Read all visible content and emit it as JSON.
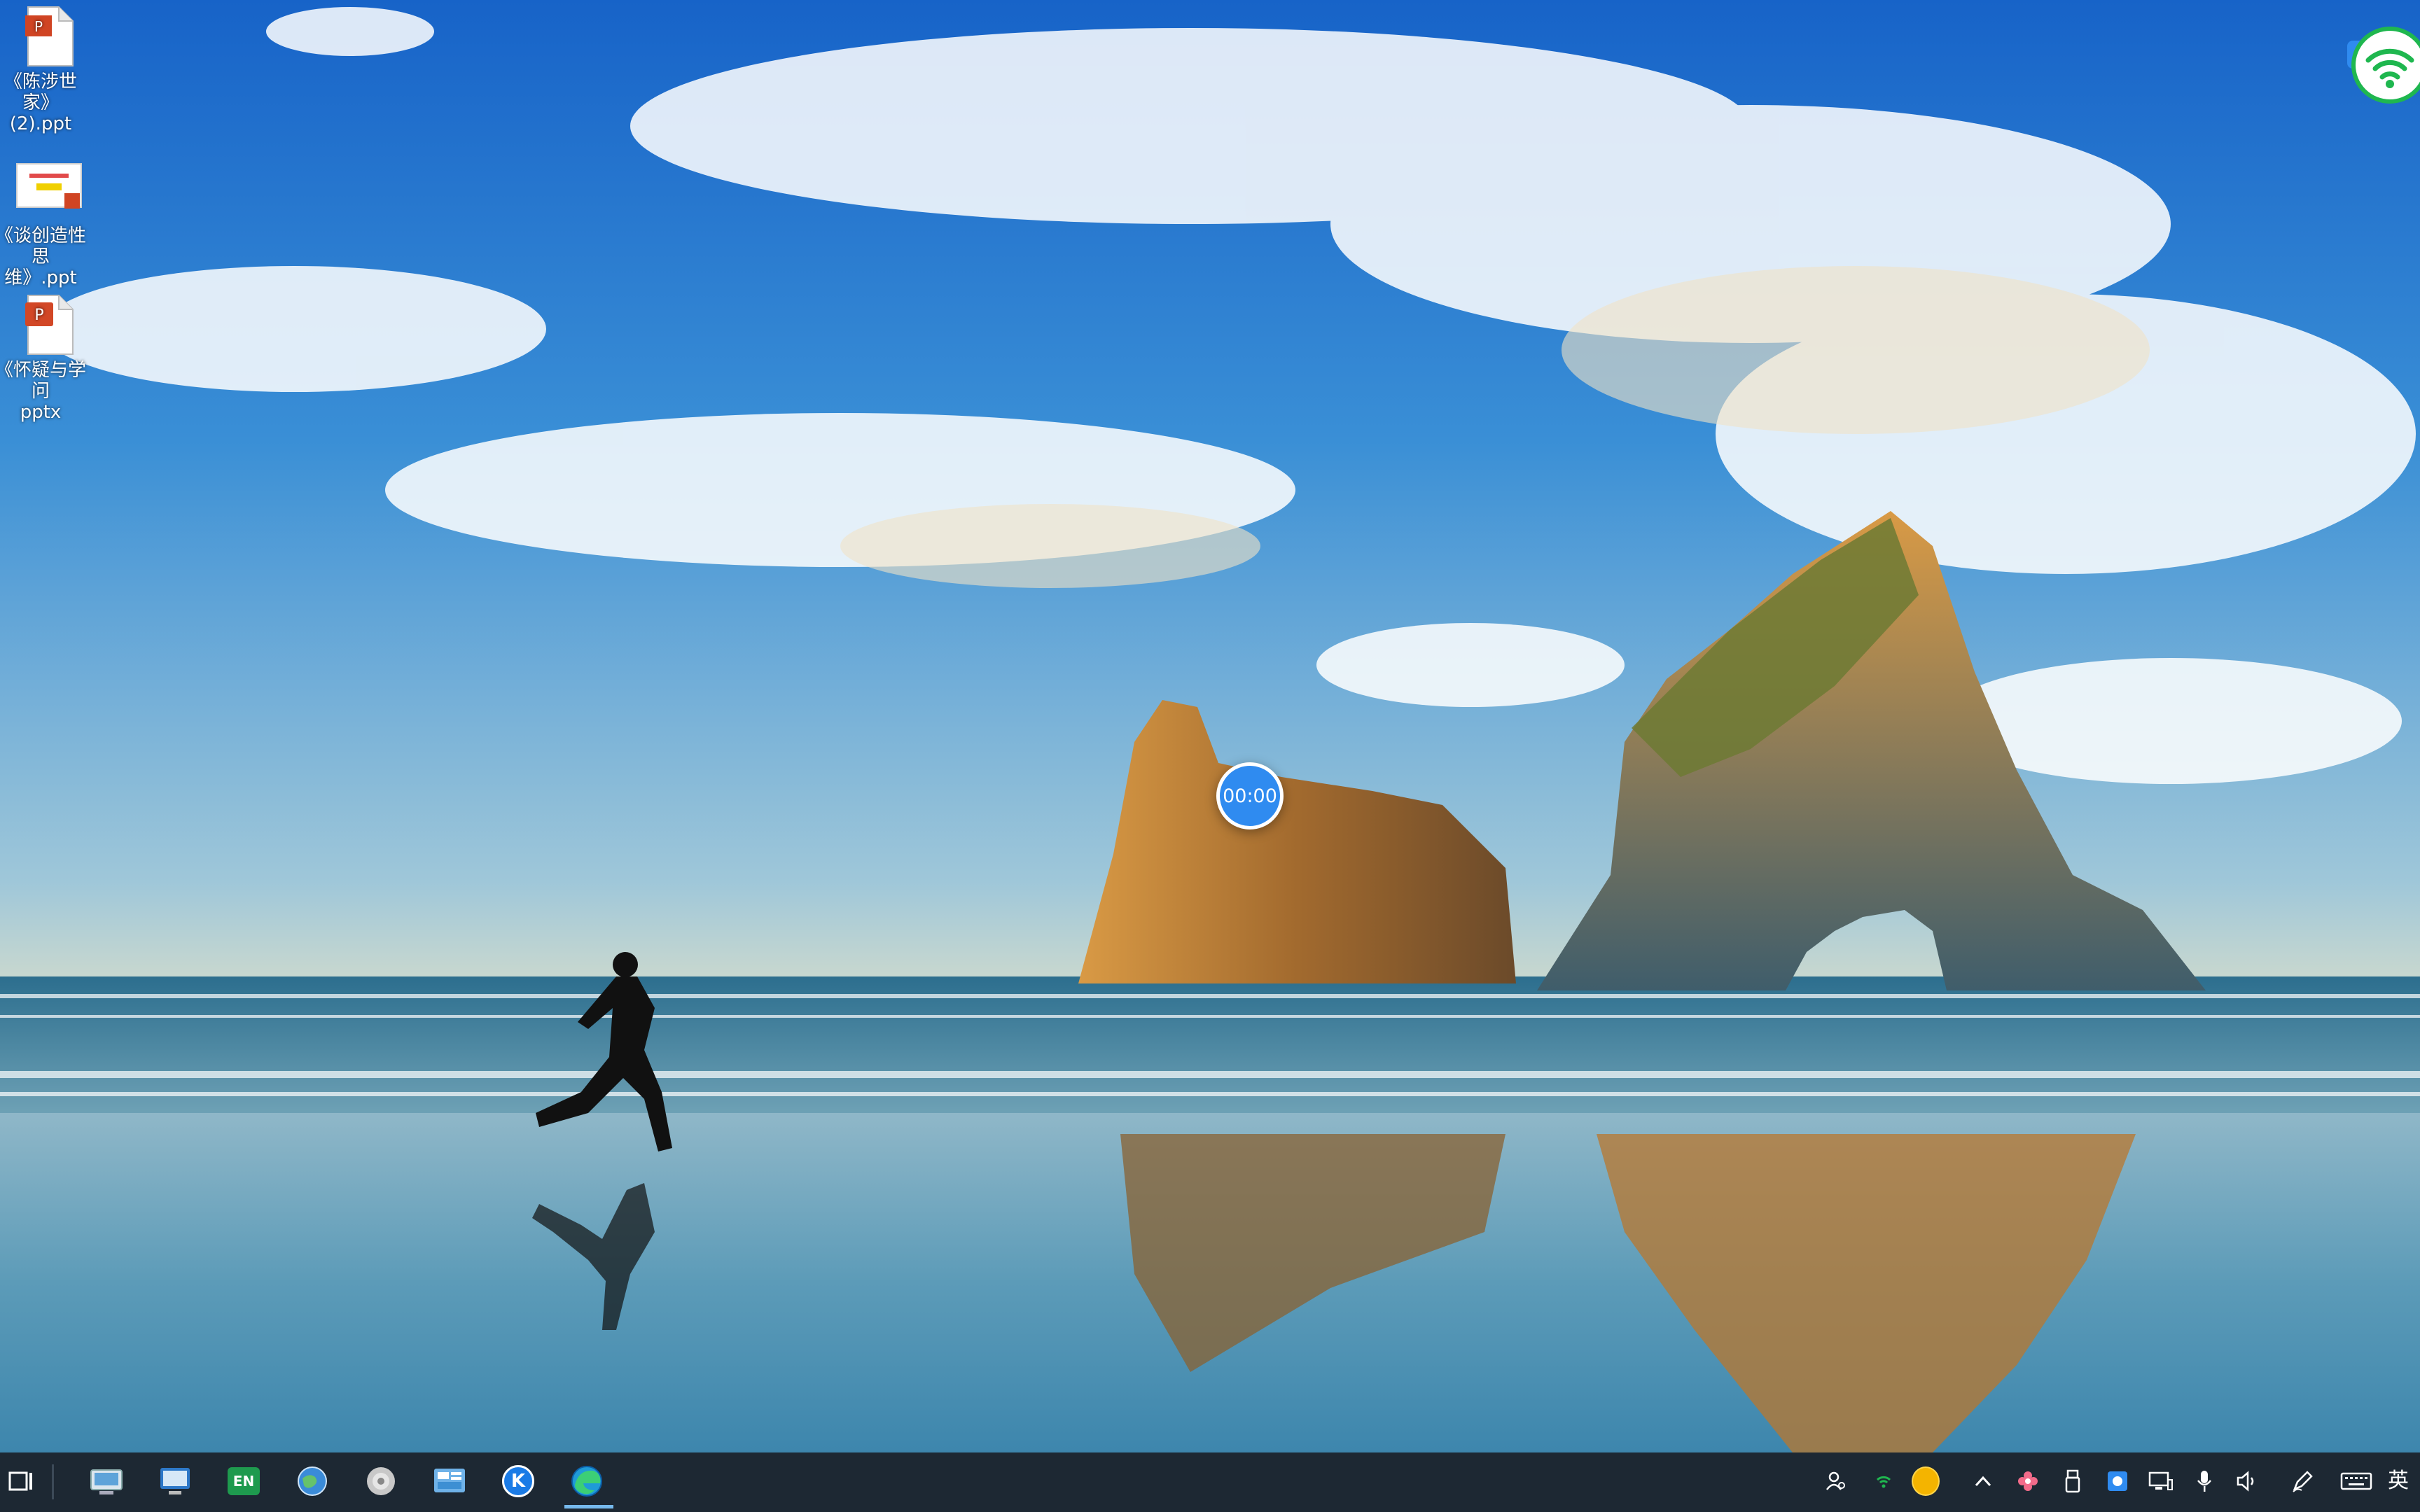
{
  "desktop": {
    "icons": [
      {
        "label_line1": "《陈涉世家》",
        "label_line2": "(2).ppt",
        "icon": "ppt-file-icon"
      },
      {
        "label_line1": "《谈创造性思",
        "label_line2": "维》.ppt",
        "icon": "ppt-thumbnail-icon"
      },
      {
        "label_line1": "《怀疑与学问",
        "label_line2": "pptx",
        "icon": "pptx-file-icon"
      }
    ],
    "timer": "00:00"
  },
  "taskbar": {
    "pinned": [
      {
        "icon": "task-view-icon"
      },
      {
        "icon": "this-pc-icon"
      },
      {
        "icon": "remote-desktop-icon"
      },
      {
        "icon": "en-app-icon",
        "text": "EN"
      },
      {
        "icon": "globe-browser-icon"
      },
      {
        "icon": "disc-icon"
      },
      {
        "icon": "control-panel-icon"
      },
      {
        "icon": "k-app-icon",
        "text": "K"
      },
      {
        "icon": "edge-icon"
      }
    ],
    "tray": [
      {
        "icon": "people-icon"
      },
      {
        "icon": "wifi-small-icon"
      },
      {
        "icon": "yellow-circle-icon"
      },
      {
        "icon": "chevron-up-icon"
      },
      {
        "icon": "flower-icon"
      },
      {
        "icon": "usb-drive-icon"
      },
      {
        "icon": "app-tray-icon"
      },
      {
        "icon": "network-monitor-icon"
      },
      {
        "icon": "microphone-icon"
      },
      {
        "icon": "volume-icon"
      },
      {
        "icon": "pen-icon"
      },
      {
        "icon": "keyboard-icon"
      }
    ],
    "language": "英"
  },
  "colors": {
    "taskbar_bg": "#1d2833",
    "timer_bg": "#2f8bf0",
    "wifi_green": "#1fb74f",
    "accent": "#76b9ed"
  }
}
